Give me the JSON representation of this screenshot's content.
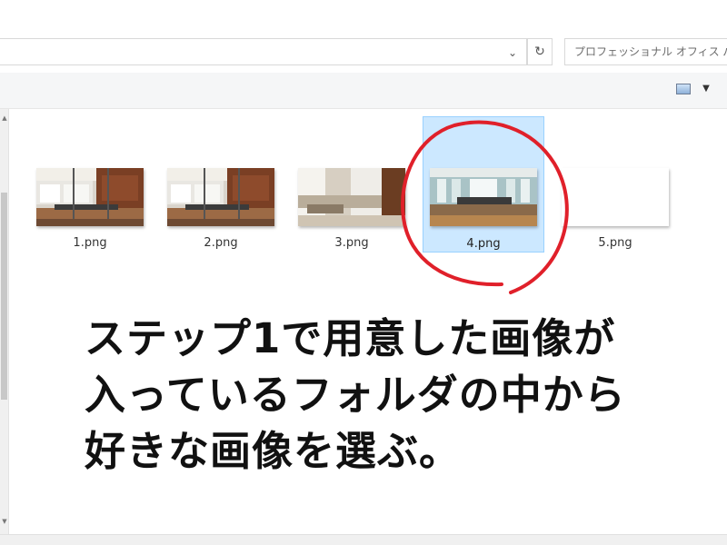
{
  "address_bar": {
    "dropdown_icon": "chevron-down-icon",
    "refresh_icon": "refresh-icon"
  },
  "search": {
    "placeholder": "プロフェッショナル オフィス パー"
  },
  "toolbar": {
    "view_icon": "view-options-icon",
    "view_dropdown_icon": "caret-down-icon"
  },
  "files": [
    {
      "name": "1.png",
      "selected": false
    },
    {
      "name": "2.png",
      "selected": false
    },
    {
      "name": "3.png",
      "selected": false
    },
    {
      "name": "4.png",
      "selected": true
    },
    {
      "name": "5.png",
      "selected": false
    }
  ],
  "annotation": {
    "color": "#e0202a",
    "lines": [
      "ステップ1で用意した画像が",
      "入っているフォルダの中から",
      "好きな画像を選ぶ。"
    ]
  },
  "colors": {
    "selection_bg": "#cce8ff",
    "selection_border": "#99d1ff",
    "toolbar_bg": "#f5f6f7"
  }
}
